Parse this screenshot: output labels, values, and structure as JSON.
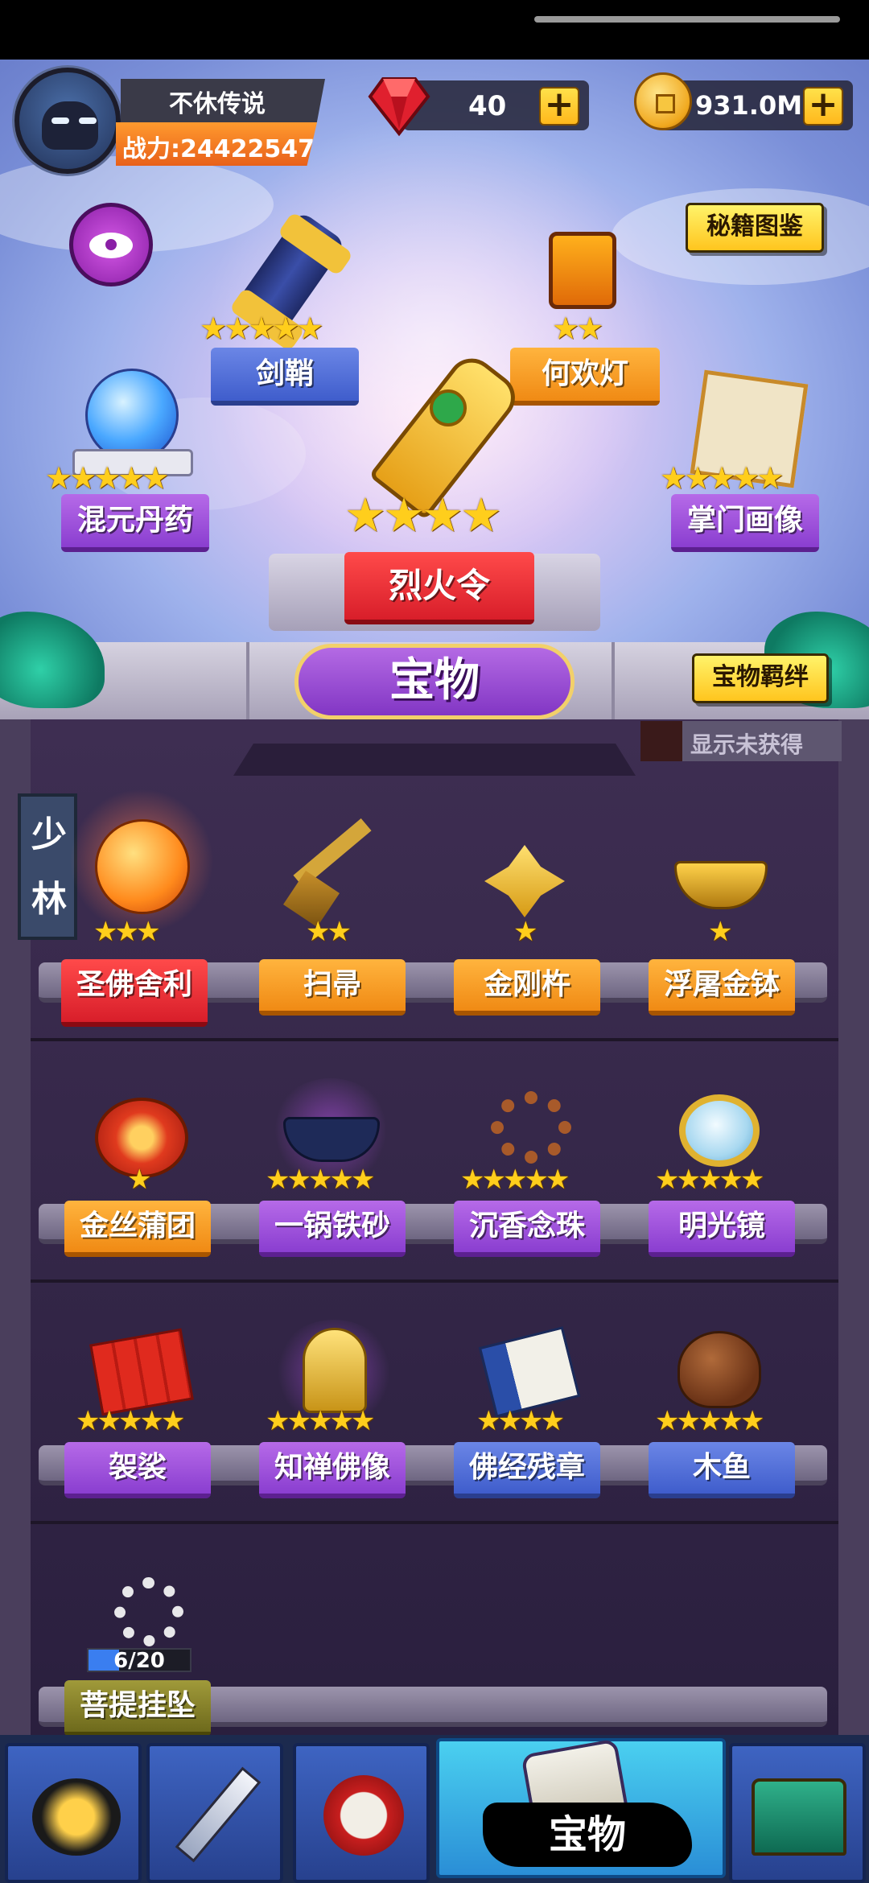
{
  "player": {
    "name": "不休传说",
    "power_label": "战力:24422547"
  },
  "resources": {
    "gems": "40",
    "gold": "931.0M"
  },
  "header_buttons": {
    "codex": "秘籍图鉴",
    "bond": "宝物羁绊"
  },
  "equipped": [
    {
      "name": "剑鞘",
      "stars": 5,
      "rarity": "blue"
    },
    {
      "name": "何欢灯",
      "stars": 2,
      "rarity": "orange"
    },
    {
      "name": "混元丹药",
      "stars": 5,
      "rarity": "purple"
    },
    {
      "name": "烈火令",
      "stars": 4,
      "rarity": "red"
    },
    {
      "name": "掌门画像",
      "stars": 5,
      "rarity": "purple"
    }
  ],
  "main_tab": "宝物",
  "show_unobtained": "显示未获得",
  "sect_tag": "少林",
  "collection": [
    {
      "name": "圣佛舍利",
      "stars": 3,
      "rarity": "red"
    },
    {
      "name": "扫帚",
      "stars": 2,
      "rarity": "orange"
    },
    {
      "name": "金刚杵",
      "stars": 1,
      "rarity": "orange"
    },
    {
      "name": "浮屠金钵",
      "stars": 1,
      "rarity": "orange"
    },
    {
      "name": "金丝蒲团",
      "stars": 1,
      "rarity": "orange"
    },
    {
      "name": "一锅铁砂",
      "stars": 5,
      "rarity": "purple"
    },
    {
      "name": "沉香念珠",
      "stars": 5,
      "rarity": "purple"
    },
    {
      "name": "明光镜",
      "stars": 5,
      "rarity": "purple"
    },
    {
      "name": "袈裟",
      "stars": 5,
      "rarity": "purple"
    },
    {
      "name": "知禅佛像",
      "stars": 5,
      "rarity": "purple"
    },
    {
      "name": "佛经残章",
      "stars": 4,
      "rarity": "blue"
    },
    {
      "name": "木鱼",
      "stars": 5,
      "rarity": "blue"
    },
    {
      "name": "菩提挂坠",
      "stars": 0,
      "rarity": "olive",
      "progress": "6/20",
      "progress_fraction": 0.3
    }
  ],
  "nav": {
    "active_label": "宝物",
    "items": [
      "hero-icon",
      "sword-icon",
      "drum-icon",
      "treasure-icon",
      "gate-icon"
    ]
  },
  "colors": {
    "red": "#d81e2a",
    "orange": "#f08a14",
    "purple": "#8a3ed0",
    "blue": "#3f5dcc",
    "star": "#ffce1c"
  }
}
